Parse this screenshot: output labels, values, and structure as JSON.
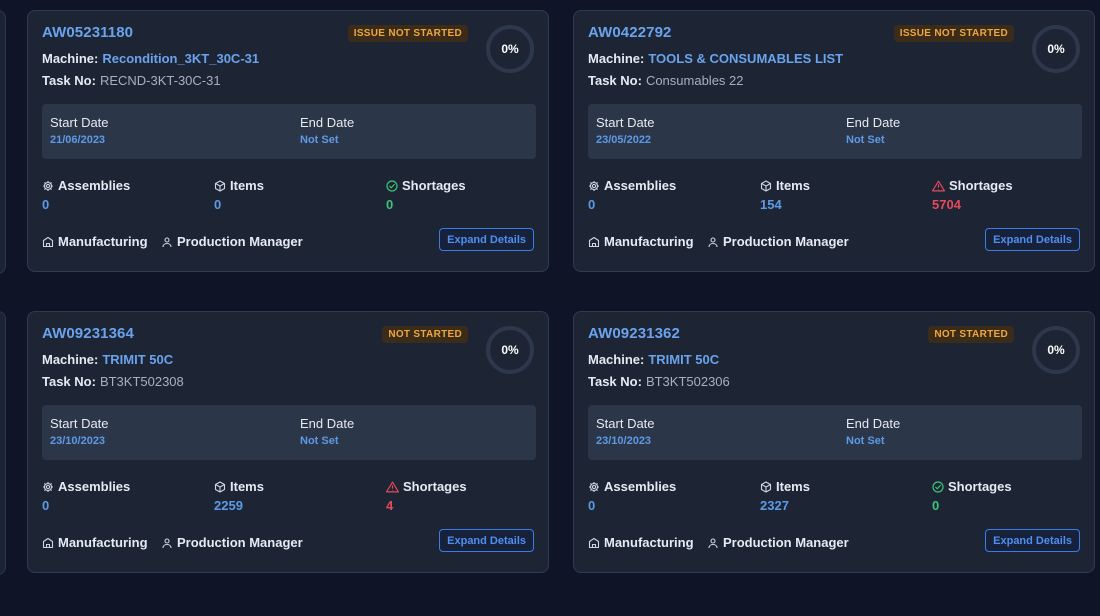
{
  "labels": {
    "machine": "Machine:",
    "task_no": "Task No:",
    "start_date": "Start Date",
    "end_date": "End Date",
    "assemblies": "Assemblies",
    "items": "Items",
    "shortages": "Shortages",
    "department": "Manufacturing",
    "role": "Production Manager",
    "expand": "Expand Details"
  },
  "colors": {
    "accent": "#6aa3ec",
    "badge_text": "#f0a640",
    "ok": "#3ec27a",
    "alert": "#e44b5a",
    "button": "#3b7de8"
  },
  "cards": [
    {
      "id": "AW05231180",
      "status": "ISSUE NOT STARTED",
      "progress": "0%",
      "machine": "Recondition_3KT_30C-31",
      "task_no": "RECND-3KT-30C-31",
      "start_date": "21/06/2023",
      "end_date": "Not Set",
      "assemblies": "0",
      "items": "0",
      "shortages": "0",
      "shortage_state": "ok"
    },
    {
      "id": "AW0422792",
      "status": "ISSUE NOT STARTED",
      "progress": "0%",
      "machine": "TOOLS & CONSUMABLES LIST",
      "task_no": "Consumables 22",
      "start_date": "23/05/2022",
      "end_date": "Not Set",
      "assemblies": "0",
      "items": "154",
      "shortages": "5704",
      "shortage_state": "alert"
    },
    {
      "id": "AW09231364",
      "status": "NOT STARTED",
      "progress": "0%",
      "machine": "TRIMIT 50C",
      "task_no": "BT3KT502308",
      "start_date": "23/10/2023",
      "end_date": "Not Set",
      "assemblies": "0",
      "items": "2259",
      "shortages": "4",
      "shortage_state": "alert"
    },
    {
      "id": "AW09231362",
      "status": "NOT STARTED",
      "progress": "0%",
      "machine": "TRIMIT 50C",
      "task_no": "BT3KT502306",
      "start_date": "23/10/2023",
      "end_date": "Not Set",
      "assemblies": "0",
      "items": "2327",
      "shortages": "0",
      "shortage_state": "ok"
    }
  ]
}
